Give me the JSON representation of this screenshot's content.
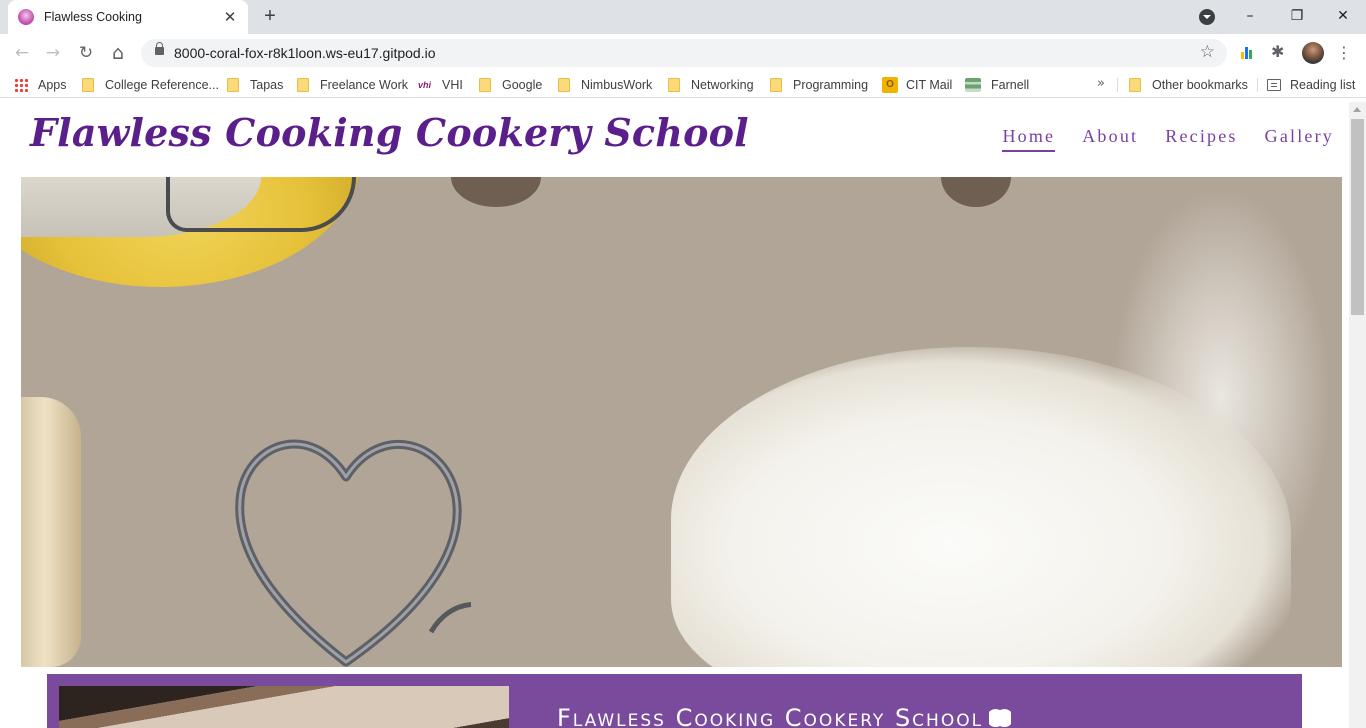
{
  "browser": {
    "tab": {
      "title": "Flawless Cooking",
      "close_glyph": "✕"
    },
    "new_tab_glyph": "+",
    "window_controls": {
      "minimize": "–",
      "restore": "❐",
      "close": "✕"
    },
    "nav": {
      "back": "←",
      "forward": "→",
      "reload": "↻",
      "home": "⌂"
    },
    "address": {
      "url": "8000-coral-fox-r8k1loon.ws-eu17.gitpod.io",
      "star_glyph": "☆"
    },
    "extensions": {
      "puzzle_glyph": "✱"
    },
    "menu_glyph": "⋮",
    "bookmarks": {
      "items": [
        {
          "label": "Apps",
          "icon": "apps-grid-icon"
        },
        {
          "label": "College Reference...",
          "icon": "folder-icon"
        },
        {
          "label": "Tapas",
          "icon": "folder-icon"
        },
        {
          "label": "Freelance Work",
          "icon": "folder-icon"
        },
        {
          "label": "VHI",
          "icon": "vhi-icon",
          "icon_text": "vhi"
        },
        {
          "label": "Google",
          "icon": "folder-icon"
        },
        {
          "label": "NimbusWork",
          "icon": "folder-icon"
        },
        {
          "label": "Networking",
          "icon": "folder-icon"
        },
        {
          "label": "Programming",
          "icon": "folder-icon"
        },
        {
          "label": "CIT Mail",
          "icon": "cit-mail-icon",
          "icon_text": "O"
        },
        {
          "label": "Farnell",
          "icon": "farnell-icon"
        }
      ],
      "more_glyph": "»",
      "other": "Other bookmarks",
      "reading_list": "Reading list"
    }
  },
  "site": {
    "logo": "Flawless Cooking Cookery School",
    "nav": [
      {
        "label": "Home",
        "active": true
      },
      {
        "label": "About",
        "active": false
      },
      {
        "label": "Recipes",
        "active": false
      },
      {
        "label": "Gallery",
        "active": false
      }
    ],
    "feature_title": "Flawless Cooking Cookery School",
    "colors": {
      "brand_purple": "#5a1f8a",
      "nav_purple": "#7b3fa0",
      "band_purple": "#7a4b9c"
    }
  }
}
